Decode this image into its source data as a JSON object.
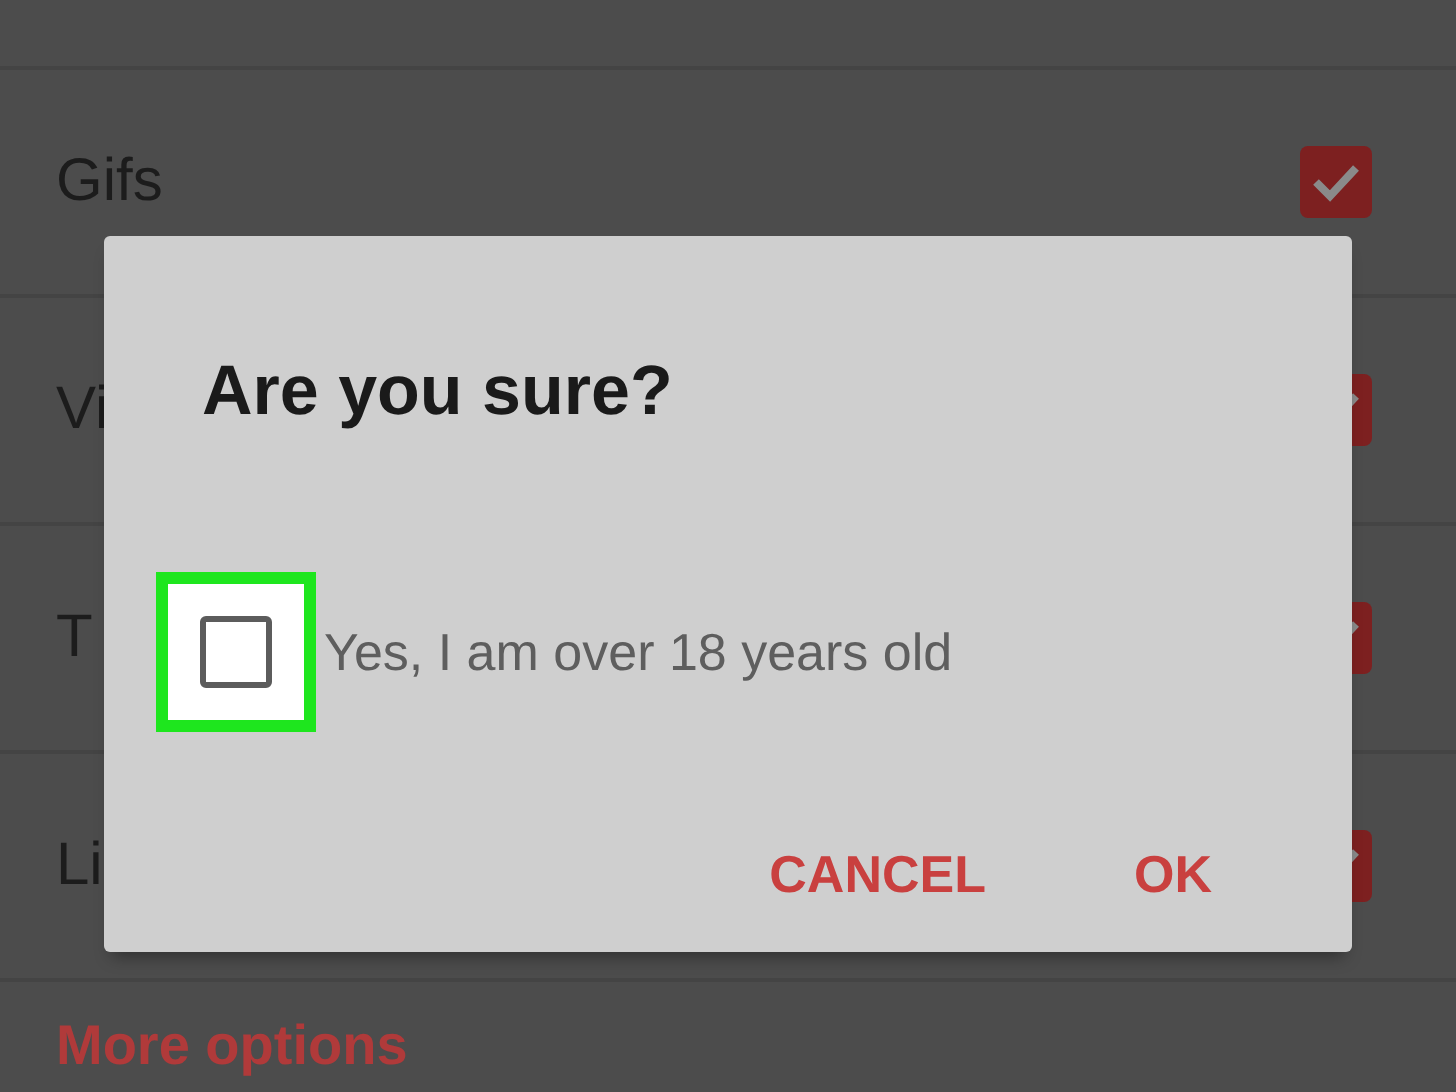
{
  "settings_list": [
    {
      "label": "Gifs",
      "checked": true
    },
    {
      "label": "Vi",
      "checked": true
    },
    {
      "label": "T",
      "checked": true
    },
    {
      "label": "Li",
      "checked": true
    }
  ],
  "more_options": "More options",
  "dialog": {
    "title": "Are you sure?",
    "checkbox": {
      "label": "Yes, I am over 18 years old",
      "checked": false
    },
    "buttons": [
      "CANCEL",
      "OK"
    ]
  }
}
